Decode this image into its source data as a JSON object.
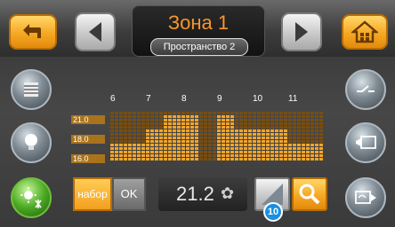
{
  "header": {
    "zone_title": "Зона 1",
    "space_label": "Пространство 2"
  },
  "chart_data": {
    "type": "heatmap",
    "x_tick_labels": [
      "6",
      "7",
      "8",
      "9",
      "10",
      "11"
    ],
    "y_tick_labels": [
      "21.0",
      "18.0",
      "16.0"
    ],
    "levels": [
      1,
      1,
      1,
      1,
      1,
      1,
      1,
      1,
      2,
      2,
      2,
      2,
      3,
      3,
      3,
      3,
      3,
      3,
      3,
      3,
      4,
      4,
      4,
      4,
      3,
      3,
      3,
      3,
      2,
      2,
      2,
      2,
      2,
      2,
      2,
      2,
      2,
      2,
      2,
      2,
      1,
      1,
      1,
      1,
      1,
      1,
      1,
      1
    ],
    "level_labels": [
      "16.0",
      "18.0",
      "21.0"
    ],
    "colors": {
      "active": "#f3a52a",
      "inactive": "#7a4e0e"
    }
  },
  "controls": {
    "set_label": "набор",
    "ok_label": "OK",
    "current_temp": "21.2",
    "badge_value": "10"
  },
  "icons": {
    "back": "back-arrow-icon",
    "home": "home-icon",
    "prev": "chevron-left-icon",
    "next": "chevron-right-icon",
    "blinds": "blinds-icon",
    "light": "bulb-icon",
    "climate": "sun-snowflake-icon",
    "switch": "switch-icon",
    "scene": "scene-icon",
    "media": "media-icon",
    "search": "search-icon",
    "fan": "fan-icon"
  },
  "colors": {
    "accent": "#f5962a",
    "active_green": "#4cab24"
  }
}
